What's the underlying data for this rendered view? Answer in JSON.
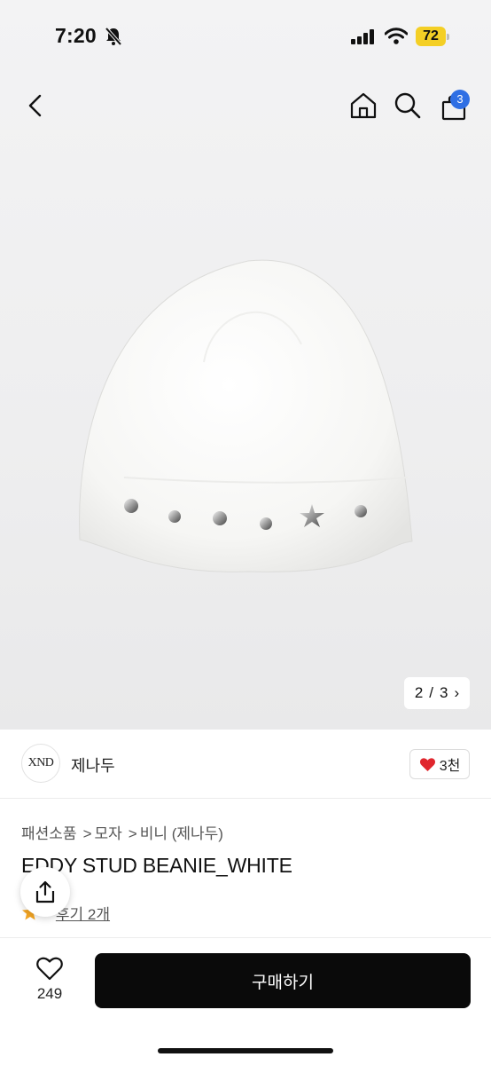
{
  "status_bar": {
    "time": "7:20",
    "battery": "72"
  },
  "nav": {
    "cart_count": "3"
  },
  "gallery": {
    "current": "2",
    "separator": "/",
    "total": "3",
    "next": "›"
  },
  "brand": {
    "logo": "XND",
    "name": "제나두",
    "likes": "3천"
  },
  "breadcrumb": {
    "level1": "패션소품",
    "level2": "모자",
    "level3": "비니 (제나두)",
    "separator": ">"
  },
  "product": {
    "title": "EDDY STUD BEANIE_WHITE",
    "rating": "5",
    "reviews": "후기 2개"
  },
  "bottom_bar": {
    "wish_count": "249",
    "buy_label": "구매하기"
  },
  "colors": {
    "badge": "#2f6fe4",
    "battery": "#f4cf25",
    "heart": "#e0262d",
    "star": "#f5a623",
    "buy_button": "#0a0a0a"
  }
}
